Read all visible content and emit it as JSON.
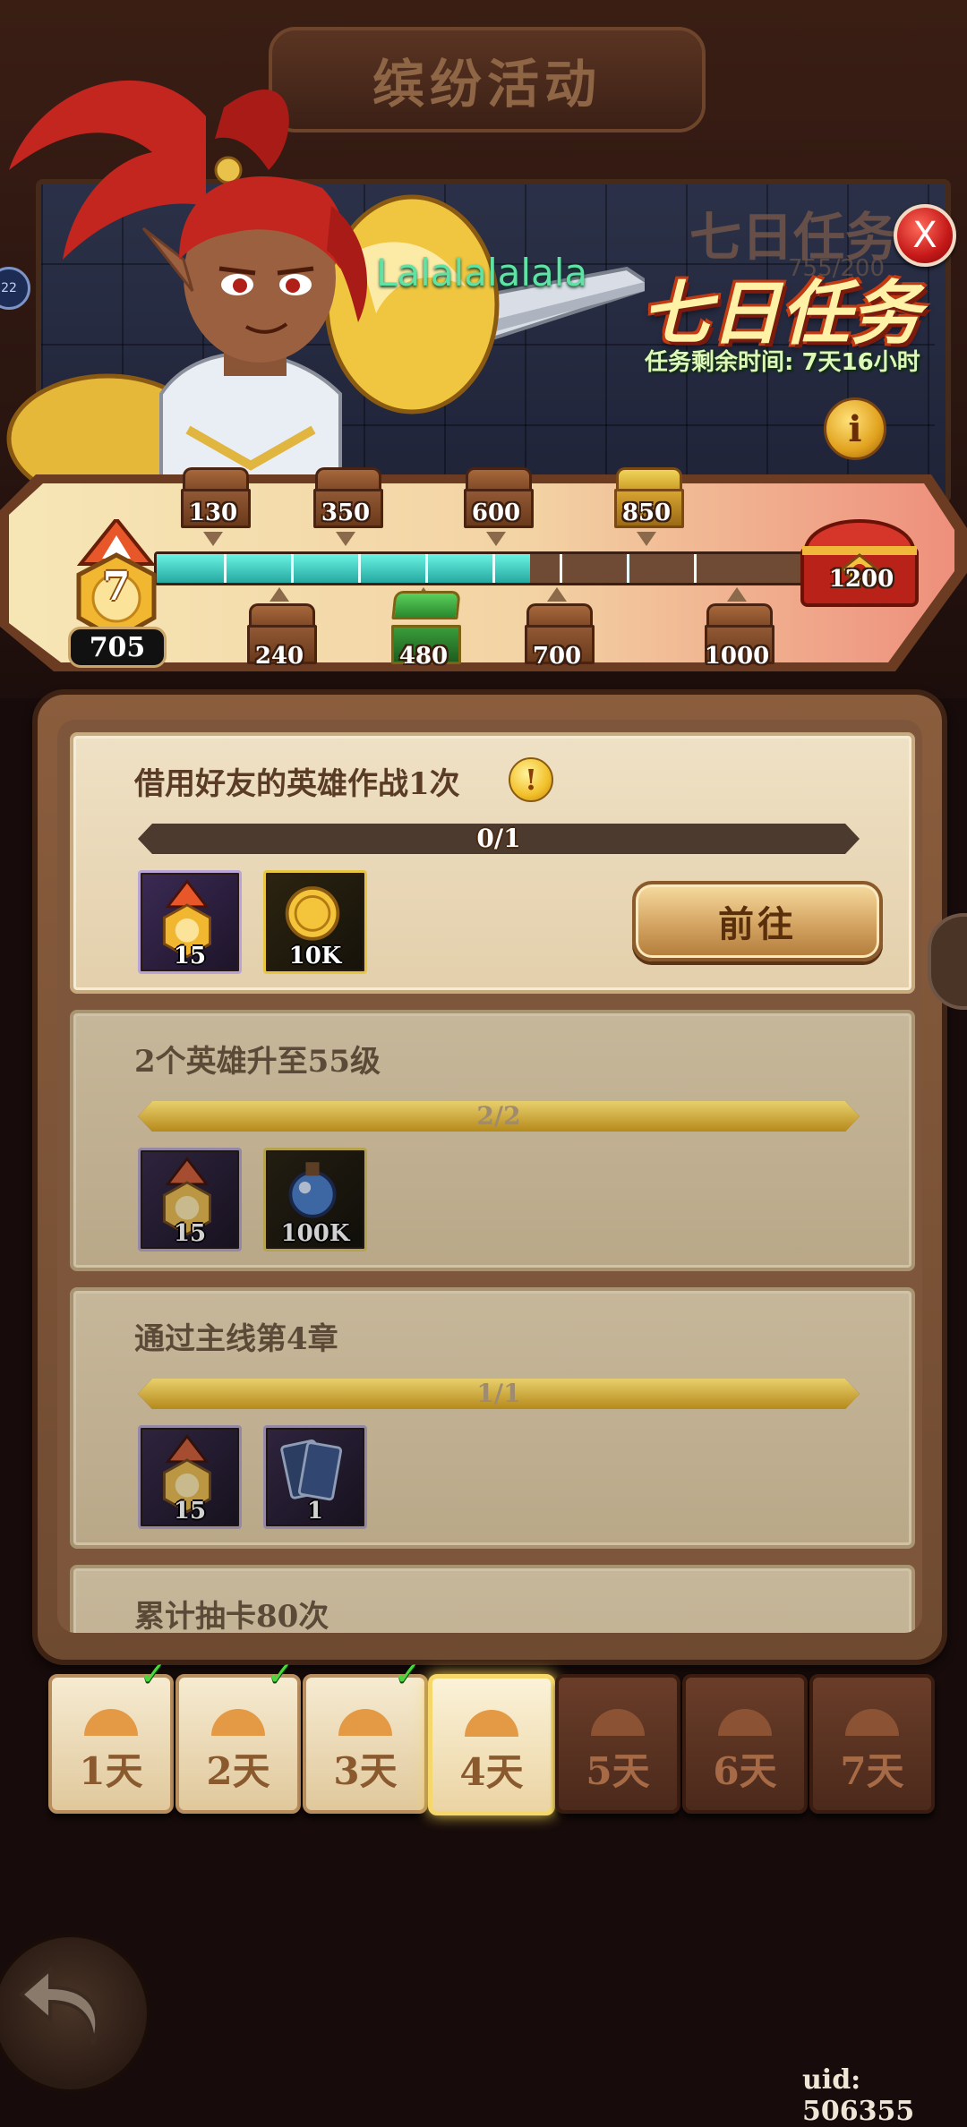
{
  "header": {
    "title": "缤纷活动",
    "left_badge": "22"
  },
  "event": {
    "ghost_title": "七日任务",
    "ghost_score": "755/200",
    "title": "七日任务",
    "player_name": "Lalalalalala",
    "timer": "任务剩余时间: 7天16小时",
    "close_label": "X",
    "info_label": "i",
    "colors": {
      "accent": "#fff2a6",
      "close": "#c41818",
      "player_name": "#5ee3a5"
    }
  },
  "progress": {
    "level": "7",
    "score": "705",
    "current_points": 705,
    "max_points": 1200,
    "top_milestones": [
      {
        "label": "130",
        "state": "claimed"
      },
      {
        "label": "350",
        "state": "claimed"
      },
      {
        "label": "600",
        "state": "claimed"
      },
      {
        "label": "850",
        "state": "locked"
      }
    ],
    "bottom_milestones": [
      {
        "label": "240",
        "state": "claimed"
      },
      {
        "label": "480",
        "state": "claimable"
      },
      {
        "label": "700",
        "state": "claimed"
      },
      {
        "label": "1000",
        "state": "locked"
      }
    ],
    "final_milestone": {
      "label": "1200",
      "state": "locked"
    }
  },
  "tasks": [
    {
      "title": "借用好友的英雄作战1次",
      "progress_text": "0/1",
      "progress": 0,
      "rewards": [
        {
          "icon": "medal-icon",
          "qty": "15",
          "style": "purple"
        },
        {
          "icon": "gold-coin-icon",
          "qty": "10K",
          "style": "gold"
        }
      ],
      "button": "前往",
      "has_warning": true,
      "warning_label": "!"
    },
    {
      "title": "2个英雄升至55级",
      "progress_text": "2/2",
      "progress": 1,
      "rewards": [
        {
          "icon": "medal-icon",
          "qty": "15",
          "style": "purple"
        },
        {
          "icon": "potion-icon",
          "qty": "100K",
          "style": "gold"
        }
      ]
    },
    {
      "title": "通过主线第4章",
      "progress_text": "1/1",
      "progress": 1,
      "rewards": [
        {
          "icon": "medal-icon",
          "qty": "15",
          "style": "purple"
        },
        {
          "icon": "card-icon",
          "qty": "1",
          "style": "purple"
        }
      ]
    },
    {
      "title": "累计抽卡80次"
    }
  ],
  "days": [
    {
      "label": "1天",
      "state": "unlocked",
      "completed": true
    },
    {
      "label": "2天",
      "state": "unlocked",
      "completed": true
    },
    {
      "label": "3天",
      "state": "unlocked",
      "completed": true
    },
    {
      "label": "4天",
      "state": "selected",
      "completed": false
    },
    {
      "label": "5天",
      "state": "locked",
      "completed": false
    },
    {
      "label": "6天",
      "state": "locked",
      "completed": false
    },
    {
      "label": "7天",
      "state": "locked",
      "completed": false
    }
  ],
  "footer": {
    "uid": "uid: 506355",
    "back_icon": "back-arrow-icon"
  }
}
